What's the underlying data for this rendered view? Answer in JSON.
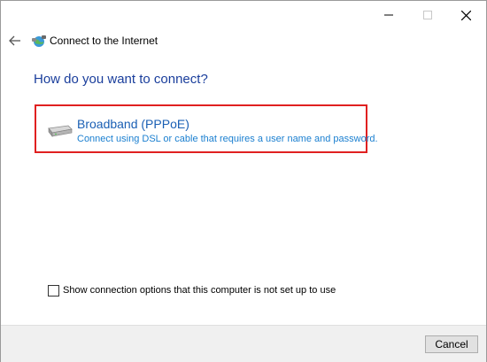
{
  "window": {
    "title": "Connect to the Internet",
    "caption_buttons": [
      "minimize",
      "maximize",
      "close"
    ]
  },
  "nav": {
    "back_icon": "back-arrow-icon",
    "wizard_icon": "network-globe-icon"
  },
  "main": {
    "heading": "How do you want to connect?",
    "options": [
      {
        "icon": "broadband-modem-icon",
        "title": "Broadband (PPPoE)",
        "description": "Connect using DSL or cable that requires a user name and password.",
        "highlighted": true
      }
    ],
    "show_options_checkbox": {
      "label": "Show connection options that this computer is not set up to use",
      "checked": false
    }
  },
  "footer": {
    "cancel_label": "Cancel"
  },
  "colors": {
    "heading": "#1a3e9c",
    "option_title": "#1a5fb4",
    "option_desc": "#1a7fd0",
    "highlight_border": "#e02020",
    "footer_bg": "#f0f0f0"
  }
}
